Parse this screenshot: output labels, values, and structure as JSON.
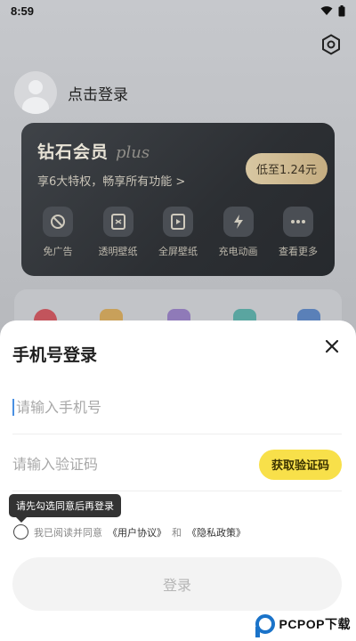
{
  "status_bar": {
    "time": "8:59"
  },
  "profile": {
    "login_prompt": "点击登录"
  },
  "vip": {
    "title": "钻石会员",
    "plus": "plus",
    "subtitle": "享6大特权，畅享所有功能 >",
    "price_badge": "低至1.24元",
    "features": [
      {
        "label": "免广告",
        "icon": "no-ads-icon"
      },
      {
        "label": "透明壁纸",
        "icon": "transparent-wallpaper-icon"
      },
      {
        "label": "全屏壁纸",
        "icon": "fullscreen-wallpaper-icon"
      },
      {
        "label": "充电动画",
        "icon": "charging-bolt-icon"
      },
      {
        "label": "查看更多",
        "icon": "more-dots-icon"
      }
    ]
  },
  "login_sheet": {
    "title": "手机号登录",
    "phone_placeholder": "请输入手机号",
    "code_placeholder": "请输入验证码",
    "get_code_label": "获取验证码",
    "tooltip": "请先勾选同意后再登录",
    "agree_prefix": "我已阅读并同意",
    "user_agreement": "《用户协议》",
    "and": "和",
    "privacy_policy": "《隐私政策》",
    "login_label": "登录"
  },
  "watermark": {
    "text": "PCPOP下载"
  },
  "colors": {
    "accent_yellow": "#f8e04a",
    "vip_card": "#2c2f33",
    "gold": "#d8c7a2"
  }
}
